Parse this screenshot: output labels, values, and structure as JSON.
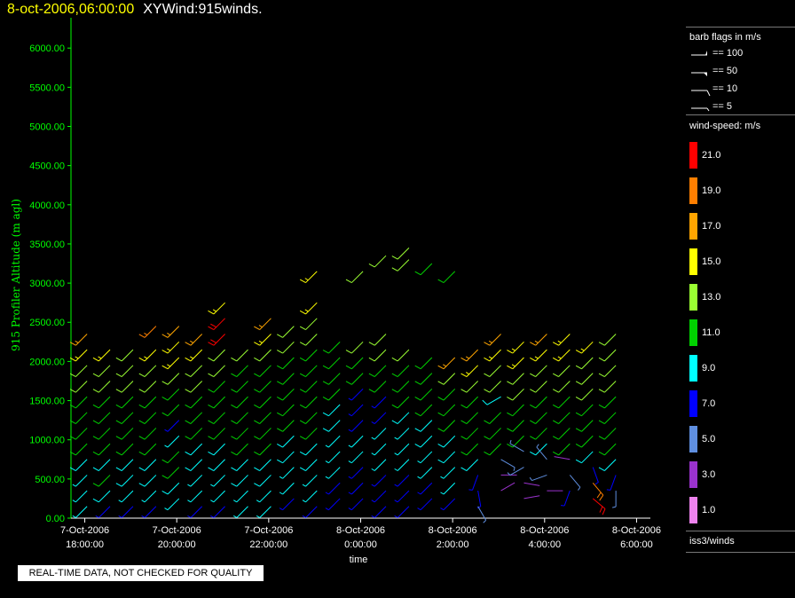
{
  "header": {
    "timestamp": "8-oct-2006,06:00:00",
    "title": "XYWind:915winds."
  },
  "colors": {
    "axis": "#00ff00",
    "tick_text": "#00ff00",
    "background": "#000000",
    "labels": "#ffffff"
  },
  "legend": {
    "barb_title": "barb flags in m/s",
    "barbs": [
      {
        "label": "== 100",
        "kind": "pennant"
      },
      {
        "label": "== 50",
        "kind": "flag"
      },
      {
        "label": "== 10",
        "kind": "full"
      },
      {
        "label": "== 5",
        "kind": "half"
      }
    ],
    "speed_title": "wind-speed: m/s",
    "scale": [
      {
        "label": "21.0",
        "color": "#ff0000"
      },
      {
        "label": "19.0",
        "color": "#ff7f00"
      },
      {
        "label": "17.0",
        "color": "#ffa500"
      },
      {
        "label": "15.0",
        "color": "#ffff00"
      },
      {
        "label": "13.0",
        "color": "#9aff32"
      },
      {
        "label": "11.0",
        "color": "#00d200"
      },
      {
        "label": "9.0",
        "color": "#00ffff"
      },
      {
        "label": "7.0",
        "color": "#0000ff"
      },
      {
        "label": "5.0",
        "color": "#5f8fe0"
      },
      {
        "label": "3.0",
        "color": "#9a32cd"
      },
      {
        "label": "1.0",
        "color": "#ee82ee"
      }
    ],
    "footer": "iss3/winds"
  },
  "note": "REAL-TIME DATA, NOT CHECKED FOR QUALITY",
  "chart_data": {
    "type": "wind-barb",
    "title": "XYWind:915winds.",
    "xlabel": "time",
    "ylabel": "915 Profiler Altitude (m agl)",
    "ylim": [
      0,
      6200
    ],
    "y_ticks": [
      "0.00",
      "500.00",
      "1000.00",
      "1500.00",
      "2000.00",
      "2500.00",
      "3000.00",
      "3500.00",
      "4000.00",
      "4500.00",
      "5000.00",
      "5500.00",
      "6000.00"
    ],
    "x_ticks": [
      {
        "hour": 0,
        "date": "7-Oct-2006",
        "time": "18:00:00"
      },
      {
        "hour": 2,
        "date": "7-Oct-2006",
        "time": "20:00:00"
      },
      {
        "hour": 4,
        "date": "7-Oct-2006",
        "time": "22:00:00"
      },
      {
        "hour": 6,
        "date": "8-Oct-2006",
        "time": "0:00:00"
      },
      {
        "hour": 8,
        "date": "8-Oct-2006",
        "time": "2:00:00"
      },
      {
        "hour": 10,
        "date": "8-Oct-2006",
        "time": "4:00:00"
      },
      {
        "hour": 12,
        "date": "8-Oct-2006",
        "time": "6:00:00"
      }
    ],
    "xlim_hours": [
      -0.3,
      12.3
    ],
    "grid": false,
    "profiles": [
      {
        "t": 0.05,
        "top": 2350,
        "levels": [
          2350,
          2150,
          1950,
          1750,
          1550,
          1350,
          1150,
          950,
          750,
          550,
          350,
          150
        ],
        "speeds": [
          17,
          15,
          14,
          13,
          12,
          12,
          12,
          11,
          10,
          9,
          9,
          9
        ],
        "dirs": [
          225,
          225,
          225,
          225,
          225,
          225,
          225,
          225,
          225,
          225,
          225,
          225
        ]
      },
      {
        "t": 0.55,
        "top": 2150,
        "levels": [
          2150,
          1950,
          1750,
          1550,
          1350,
          1150,
          950,
          750,
          550,
          350,
          150
        ],
        "speeds": [
          15,
          14,
          13,
          12,
          12,
          11,
          11,
          10,
          12,
          10,
          8
        ],
        "dirs": [
          225,
          225,
          225,
          225,
          225,
          225,
          225,
          225,
          225,
          225,
          225
        ]
      },
      {
        "t": 1.05,
        "top": 2150,
        "levels": [
          2150,
          1950,
          1750,
          1550,
          1350,
          1150,
          950,
          750,
          550,
          350,
          150
        ],
        "speeds": [
          14,
          13,
          13,
          12,
          12,
          11,
          11,
          10,
          10,
          9,
          7
        ],
        "dirs": [
          225,
          225,
          225,
          225,
          225,
          225,
          225,
          225,
          225,
          225,
          225
        ]
      },
      {
        "t": 1.55,
        "top": 2150,
        "levels": [
          2450,
          2150,
          1950,
          1750,
          1550,
          1350,
          1150,
          950,
          750,
          550,
          350,
          150
        ],
        "speeds": [
          19,
          15,
          14,
          13,
          12,
          12,
          11,
          11,
          10,
          10,
          9,
          8
        ],
        "dirs": [
          225,
          225,
          225,
          225,
          225,
          225,
          225,
          225,
          225,
          225,
          225,
          225
        ]
      },
      {
        "t": 2.05,
        "top": 2450,
        "levels": [
          2450,
          2250,
          2050,
          1850,
          1650,
          1450,
          1250,
          1050,
          850,
          650,
          450,
          250
        ],
        "speeds": [
          18,
          16,
          15,
          13,
          12,
          12,
          8,
          9,
          11,
          11,
          10,
          9
        ],
        "dirs": [
          225,
          225,
          225,
          225,
          225,
          225,
          225,
          225,
          225,
          225,
          225,
          225
        ]
      },
      {
        "t": 2.55,
        "top": 2350,
        "levels": [
          2350,
          2150,
          1950,
          1750,
          1550,
          1350,
          1150,
          950,
          750,
          550,
          350,
          150
        ],
        "speeds": [
          17,
          16,
          14,
          13,
          12,
          11,
          11,
          10,
          10,
          9,
          9,
          8
        ],
        "dirs": [
          225,
          225,
          225,
          225,
          225,
          225,
          225,
          225,
          225,
          225,
          225,
          225
        ]
      },
      {
        "t": 3.05,
        "top": 2750,
        "levels": [
          2750,
          2550,
          2350,
          2150,
          1950,
          1750,
          1550,
          1350,
          1150,
          950,
          750,
          550,
          350,
          150
        ],
        "speeds": [
          15,
          21,
          21,
          14,
          13,
          12,
          12,
          11,
          11,
          10,
          10,
          9,
          9,
          8
        ],
        "dirs": [
          225,
          225,
          225,
          225,
          225,
          225,
          225,
          225,
          225,
          225,
          225,
          225,
          225,
          225
        ]
      },
      {
        "t": 3.55,
        "top": 2150,
        "levels": [
          2150,
          1950,
          1750,
          1550,
          1350,
          1150,
          950,
          750,
          550,
          350,
          150
        ],
        "speeds": [
          13,
          12,
          12,
          12,
          11,
          11,
          11,
          10,
          10,
          9,
          9
        ],
        "dirs": [
          225,
          225,
          225,
          225,
          225,
          225,
          225,
          225,
          225,
          225,
          225
        ]
      },
      {
        "t": 4.05,
        "top": 2550,
        "levels": [
          2550,
          2350,
          2150,
          1950,
          1750,
          1550,
          1350,
          1150,
          950,
          750,
          550,
          350,
          150
        ],
        "speeds": [
          17,
          15,
          13,
          12,
          12,
          12,
          11,
          11,
          11,
          10,
          10,
          9,
          9
        ],
        "dirs": [
          225,
          225,
          225,
          225,
          225,
          225,
          225,
          225,
          225,
          225,
          225,
          225,
          225
        ]
      },
      {
        "t": 4.55,
        "top": 2450,
        "levels": [
          2450,
          2250,
          2050,
          1850,
          1650,
          1450,
          1250,
          1050,
          850,
          650,
          450,
          250
        ],
        "speeds": [
          14,
          13,
          12,
          12,
          12,
          11,
          11,
          10,
          10,
          9,
          9,
          8
        ],
        "dirs": [
          225,
          225,
          225,
          225,
          225,
          225,
          225,
          225,
          225,
          225,
          225,
          225
        ]
      },
      {
        "t": 5.05,
        "top": 2750,
        "levels": [
          3150,
          2750,
          2550,
          2350,
          2150,
          1950,
          1750,
          1550,
          1350,
          1150,
          950,
          750,
          550,
          350,
          150
        ],
        "speeds": [
          15,
          15,
          13,
          13,
          12,
          12,
          12,
          11,
          11,
          11,
          10,
          10,
          9,
          9,
          8
        ],
        "dirs": [
          225,
          225,
          225,
          225,
          225,
          225,
          225,
          225,
          225,
          225,
          225,
          225,
          225,
          225,
          225
        ]
      },
      {
        "t": 5.55,
        "top": 2250,
        "levels": [
          2250,
          2050,
          1850,
          1650,
          1450,
          1250,
          1050,
          850,
          650,
          450,
          250
        ],
        "speeds": [
          12,
          12,
          11,
          11,
          10,
          10,
          9,
          9,
          9,
          8,
          8
        ],
        "dirs": [
          225,
          225,
          225,
          225,
          225,
          225,
          225,
          225,
          225,
          225,
          225
        ]
      },
      {
        "t": 6.05,
        "top": 2250,
        "levels": [
          3150,
          2250,
          2050,
          1850,
          1650,
          1450,
          1250,
          1050,
          850,
          650,
          450,
          250
        ],
        "speeds": [
          14,
          13,
          12,
          12,
          7,
          8,
          7,
          9,
          9,
          8,
          8,
          7
        ],
        "dirs": [
          225,
          225,
          225,
          225,
          225,
          225,
          225,
          225,
          225,
          225,
          225,
          225
        ]
      },
      {
        "t": 6.55,
        "top": 2350,
        "levels": [
          3350,
          2350,
          2150,
          1950,
          1750,
          1550,
          1350,
          1150,
          950,
          750,
          550,
          350,
          150
        ],
        "speeds": [
          13,
          14,
          13,
          12,
          12,
          7,
          8,
          9,
          9,
          9,
          8,
          8,
          7
        ],
        "dirs": [
          225,
          225,
          225,
          225,
          225,
          225,
          225,
          225,
          225,
          225,
          225,
          225,
          225
        ]
      },
      {
        "t": 7.05,
        "top": 2150,
        "levels": [
          3450,
          3300,
          2150,
          1950,
          1750,
          1550,
          1350,
          1150,
          950,
          750,
          550,
          350,
          150
        ],
        "speeds": [
          13,
          13,
          13,
          12,
          11,
          11,
          10,
          9,
          9,
          9,
          8,
          8,
          7
        ],
        "dirs": [
          225,
          225,
          225,
          225,
          225,
          225,
          225,
          225,
          225,
          225,
          225,
          225,
          225
        ]
      },
      {
        "t": 7.55,
        "top": 2050,
        "levels": [
          3250,
          2050,
          1850,
          1650,
          1450,
          1250,
          1050,
          850,
          650,
          450,
          250
        ],
        "speeds": [
          11,
          12,
          12,
          11,
          11,
          10,
          10,
          9,
          9,
          8,
          8
        ],
        "dirs": [
          225,
          225,
          225,
          225,
          225,
          225,
          225,
          225,
          225,
          225,
          225
        ]
      },
      {
        "t": 8.05,
        "top": 2050,
        "levels": [
          3150,
          2050,
          1850,
          1650,
          1450,
          1250,
          1050,
          850,
          650,
          450,
          250
        ],
        "speeds": [
          11,
          17,
          13,
          12,
          11,
          11,
          10,
          10,
          9,
          9,
          8
        ],
        "dirs": [
          225,
          225,
          225,
          225,
          225,
          225,
          225,
          225,
          225,
          225,
          225
        ]
      },
      {
        "t": 8.55,
        "top": 2150,
        "levels": [
          2150,
          1950,
          1750,
          1550,
          1350,
          1150,
          950,
          750,
          550,
          350,
          150
        ],
        "speeds": [
          17,
          15,
          13,
          12,
          12,
          11,
          11,
          10,
          7,
          7,
          5
        ],
        "dirs": [
          225,
          225,
          225,
          225,
          225,
          225,
          225,
          225,
          200,
          170,
          150
        ]
      },
      {
        "t": 9.05,
        "top": 2350,
        "levels": [
          2350,
          2150,
          1950,
          1750,
          1550,
          1350,
          1150,
          950,
          750,
          550,
          350
        ],
        "speeds": [
          18,
          16,
          14,
          13,
          10,
          12,
          12,
          11,
          5,
          3,
          4
        ],
        "dirs": [
          225,
          225,
          225,
          225,
          240,
          225,
          225,
          225,
          120,
          90,
          60
        ]
      },
      {
        "t": 9.55,
        "top": 2250,
        "levels": [
          2250,
          2050,
          1850,
          1650,
          1450,
          1250,
          1050,
          850,
          650,
          450,
          250
        ],
        "speeds": [
          16,
          15,
          14,
          13,
          12,
          12,
          11,
          5,
          6,
          4,
          3
        ],
        "dirs": [
          225,
          225,
          225,
          225,
          225,
          225,
          225,
          300,
          240,
          100,
          80
        ]
      },
      {
        "t": 10.05,
        "top": 2350,
        "levels": [
          2350,
          2150,
          1950,
          1750,
          1550,
          1350,
          1150,
          950,
          750,
          550,
          350
        ],
        "speeds": [
          17,
          15,
          14,
          13,
          12,
          11,
          11,
          10,
          5,
          6,
          4
        ],
        "dirs": [
          225,
          225,
          225,
          225,
          225,
          225,
          225,
          225,
          320,
          250,
          90
        ]
      },
      {
        "t": 10.55,
        "top": 2350,
        "levels": [
          2350,
          2150,
          1950,
          1750,
          1550,
          1350,
          1150,
          950,
          750,
          550,
          350
        ],
        "speeds": [
          16,
          15,
          14,
          13,
          12,
          12,
          11,
          11,
          4,
          5,
          7
        ],
        "dirs": [
          225,
          225,
          225,
          225,
          225,
          225,
          225,
          225,
          280,
          140,
          200
        ]
      },
      {
        "t": 11.05,
        "top": 2250,
        "levels": [
          2250,
          2050,
          1850,
          1650,
          1450,
          1250,
          1050,
          850,
          650,
          450,
          250
        ],
        "speeds": [
          15,
          14,
          13,
          13,
          12,
          12,
          11,
          10,
          7,
          20,
          21
        ],
        "dirs": [
          225,
          225,
          225,
          225,
          225,
          225,
          225,
          225,
          160,
          140,
          130
        ]
      },
      {
        "t": 11.55,
        "top": 2350,
        "levels": [
          2350,
          2150,
          1950,
          1750,
          1550,
          1350,
          1150,
          950,
          750,
          550,
          350
        ],
        "speeds": [
          14,
          14,
          13,
          13,
          12,
          12,
          11,
          11,
          10,
          7,
          6
        ],
        "dirs": [
          225,
          225,
          225,
          225,
          225,
          225,
          225,
          225,
          225,
          200,
          180
        ]
      }
    ]
  }
}
